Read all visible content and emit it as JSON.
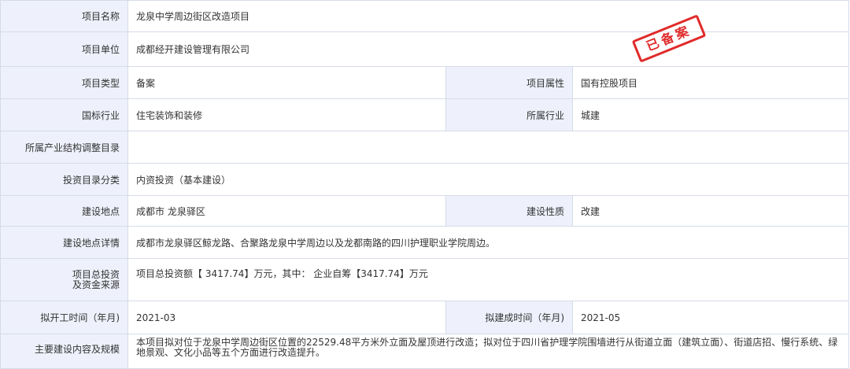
{
  "rows": {
    "project_name": {
      "label": "项目名称",
      "value": "龙泉中学周边街区改造项目"
    },
    "project_unit": {
      "label": "项目单位",
      "value": "成都经开建设管理有限公司"
    },
    "project_type": {
      "label": "项目类型",
      "value": "备案"
    },
    "project_attr": {
      "label": "项目属性",
      "value": "国有控股项目"
    },
    "national_industry": {
      "label": "国标行业",
      "value": "住宅装饰和装修"
    },
    "industry": {
      "label": "所属行业",
      "value": "城建"
    },
    "industry_catalog": {
      "label": "所属产业结构调整目录",
      "value": ""
    },
    "investment_category": {
      "label": "投资目录分类",
      "value": "内资投资（基本建设）"
    },
    "location": {
      "label": "建设地点",
      "value": "成都市 龙泉驿区"
    },
    "construction_nature": {
      "label": "建设性质",
      "value": "改建"
    },
    "location_detail": {
      "label": "建设地点详情",
      "value": "成都市龙泉驿区鲸龙路、合聚路龙泉中学周边以及龙都南路的四川护理职业学院周边。"
    },
    "total_investment": {
      "label_line1": "项目总投资",
      "label_line2": "及资金来源",
      "value": "项目总投资额【 3417.74】万元，其中： 企业自筹【3417.74】万元"
    },
    "start_time": {
      "label": "拟开工时间（年月)",
      "value": "2021-03"
    },
    "completion_time": {
      "label": "拟建成时间（年月)",
      "value": "2021-05"
    },
    "scope": {
      "label": "主要建设内容及规模",
      "value": "本项目拟对位于龙泉中学周边街区位置的22529.48平方米外立面及屋顶进行改造；拟对位于四川省护理学院围墙进行从街道立面（建筑立面）、街道店招、慢行系统、绿地景观、文化小品等五个方面进行改造提升。"
    }
  },
  "stamp": {
    "text": "已备案",
    "color": "#e02a2a"
  }
}
